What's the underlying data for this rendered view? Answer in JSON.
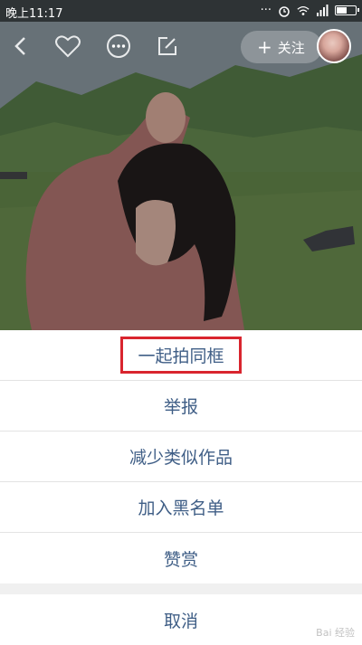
{
  "status_bar": {
    "time": "晚上11:17",
    "battery_level": 0.6
  },
  "top_bar": {
    "follow_label": "关注",
    "icons": [
      "back-icon",
      "heart-icon",
      "more-icon",
      "edit-icon"
    ]
  },
  "action_sheet": {
    "items": [
      {
        "label": "一起拍同框",
        "highlighted": true
      },
      {
        "label": "举报"
      },
      {
        "label": "减少类似作品"
      },
      {
        "label": "加入黑名单"
      },
      {
        "label": "赞赏"
      }
    ],
    "cancel_label": "取消"
  },
  "colors": {
    "sheet_text": "#3f5e86",
    "highlight_border": "#d9252e"
  },
  "watermark": "Bai 经验"
}
